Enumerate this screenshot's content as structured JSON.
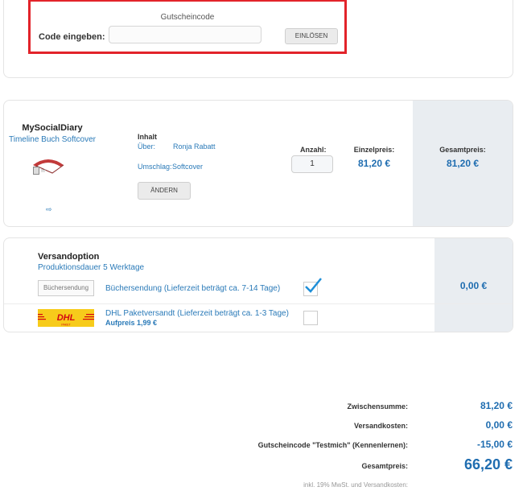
{
  "voucher": {
    "title": "Gutscheincode",
    "label": "Code eingeben:",
    "input_value": "",
    "input_placeholder": "",
    "redeem_button": "EINLÖSEN"
  },
  "product": {
    "name": "MySocialDiary",
    "subtitle": "Timeline Buch Softcover",
    "arrow": "⇨",
    "inhalt_label": "Inhalt",
    "uber_label": "Über:",
    "uber_value": "Ronja Rabatt",
    "umschlag_label": "Umschlag:",
    "umschlag_value": "Softcover",
    "change_button": "ÄNDERN",
    "quantity_label": "Anzahl:",
    "quantity_value": "1",
    "unit_price_label": "Einzelpreis:",
    "unit_price": "81,20 €",
    "total_price_label": "Gesamtpreis:",
    "total_price": "81,20 €"
  },
  "shipping": {
    "title": "Versandoption",
    "subtitle": "Produktionsdauer 5 Werktage",
    "options": [
      {
        "logo_text": "Büchersendung",
        "text": "Büchersendung (Lieferzeit beträgt ca. 7-14 Tage)",
        "checked": true
      },
      {
        "logo_text": "DHL",
        "logo_subtext": "PAKET",
        "text": "DHL Paketversandt (Lieferzeit beträgt ca. 1-3 Tage)",
        "surcharge": "Aufpreis 1,99 €",
        "checked": false
      }
    ],
    "price": "0,00 €"
  },
  "summary": {
    "subtotal_label": "Zwischensumme:",
    "subtotal": "81,20 €",
    "shipping_label": "Versandkosten:",
    "shipping": "0,00 €",
    "voucher_label": "Gutscheincode \"Testmich\" (Kennenlernen):",
    "voucher": "-15,00 €",
    "total_label": "Gesamtpreis:",
    "total": "66,20 €",
    "note": "inkl. 19% MwSt. und Versandkosten:"
  },
  "colors": {
    "accent_blue": "#1f6db0",
    "link_blue": "#2a7ab8",
    "highlight_red": "#e2232a",
    "dhl_yellow": "#f7cb1b",
    "dhl_red": "#d40511",
    "panel_gray": "#e9edf1"
  }
}
